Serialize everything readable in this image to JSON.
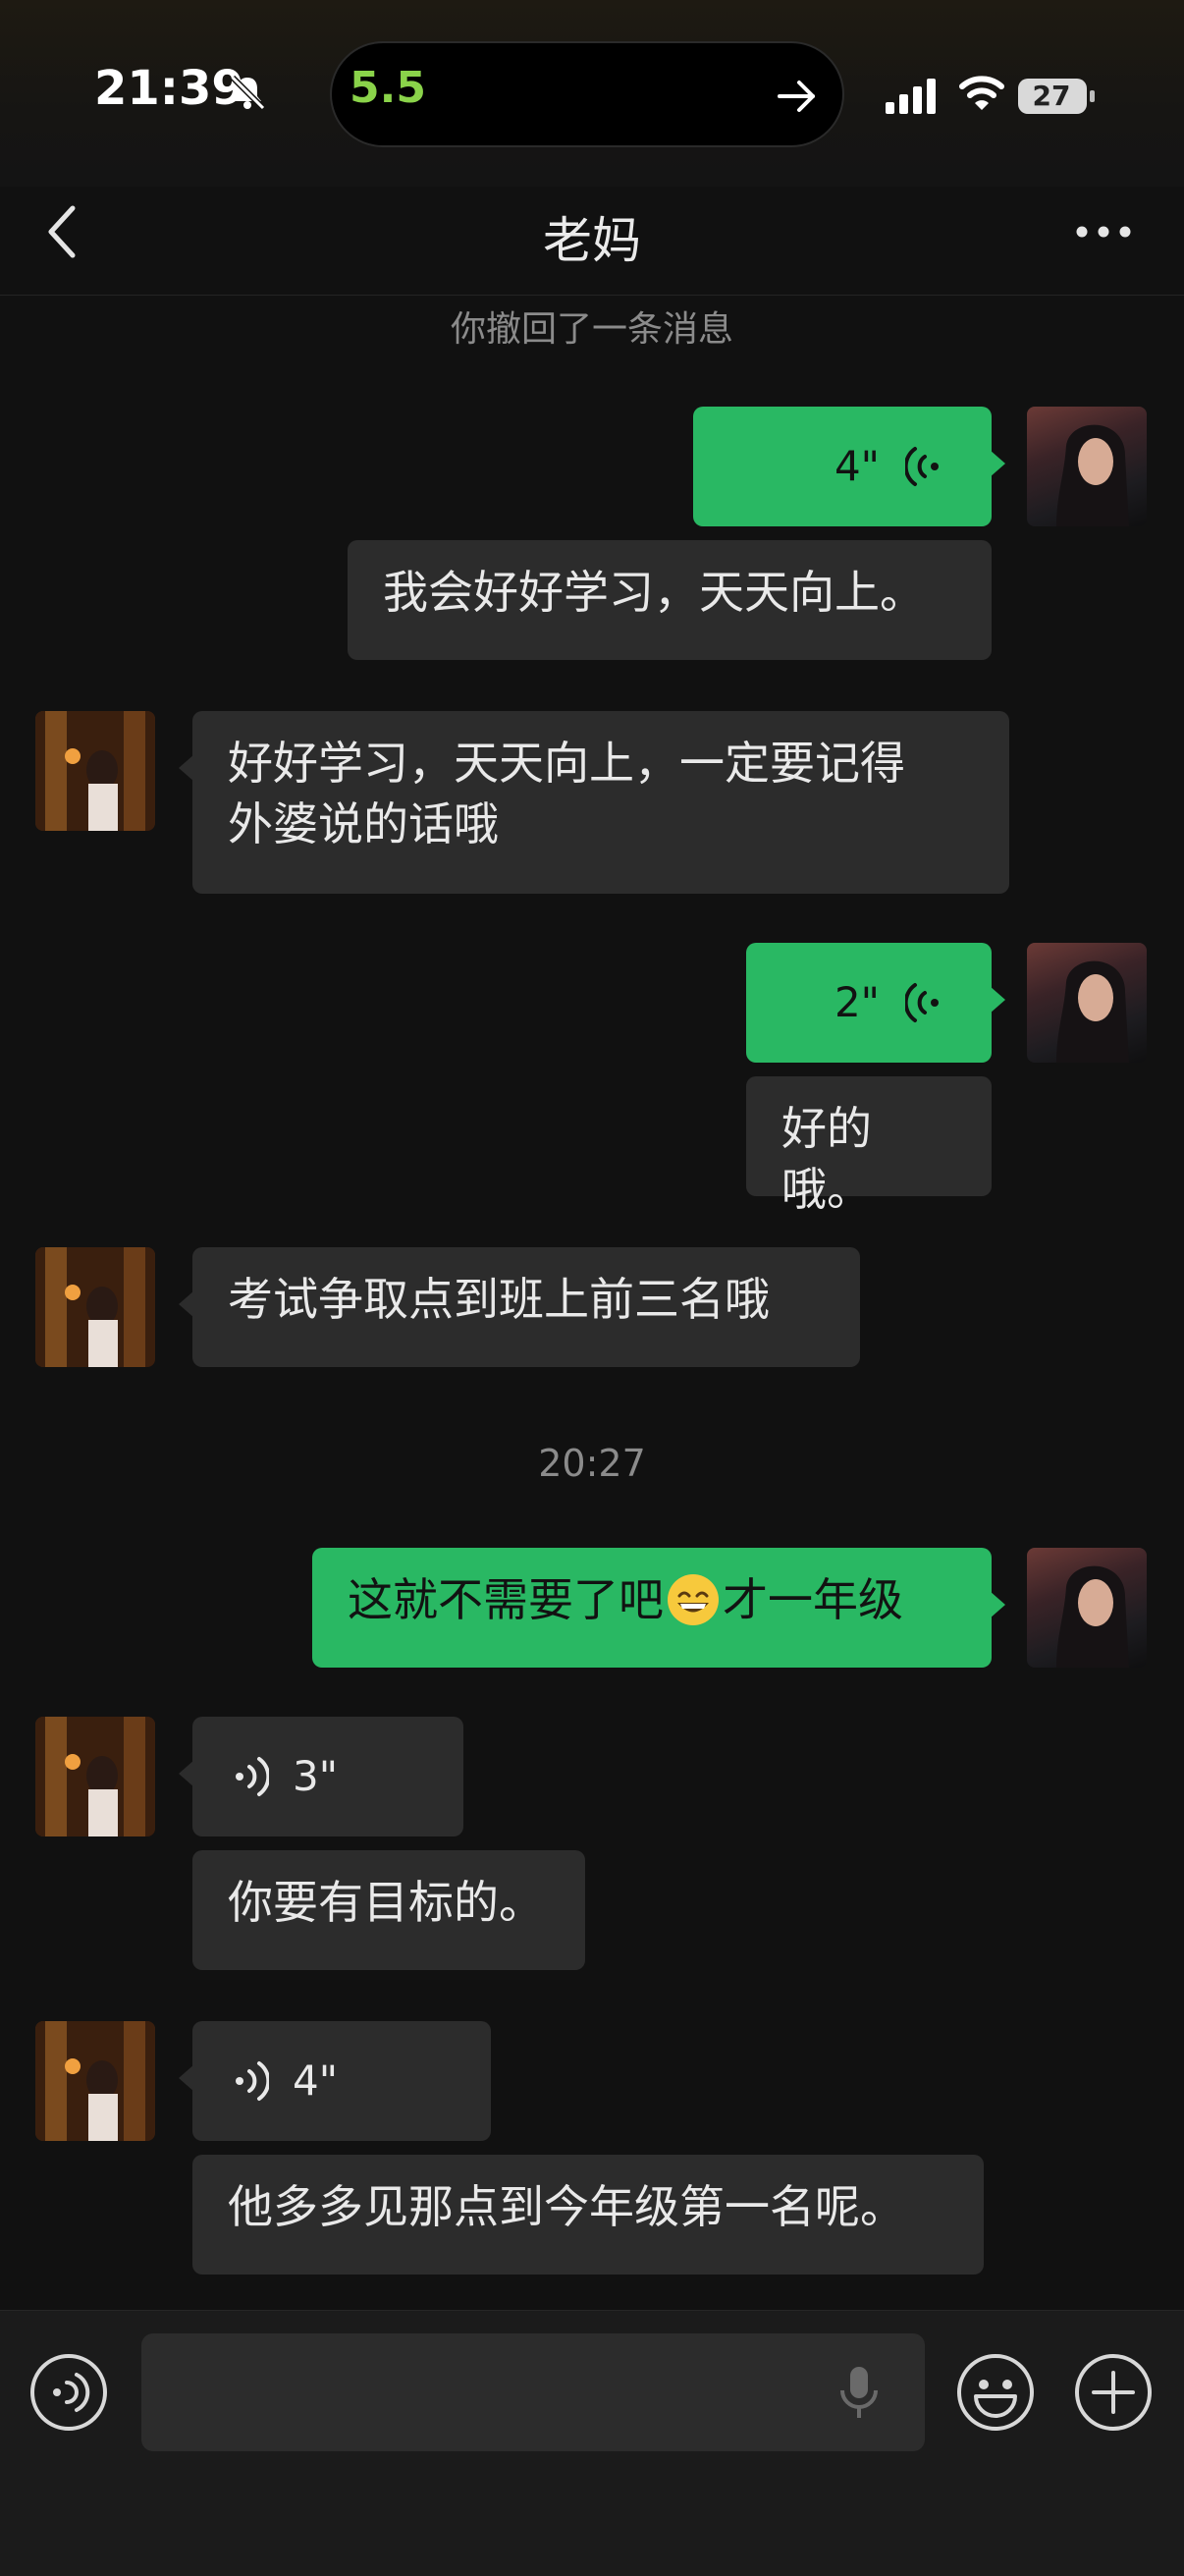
{
  "status_bar": {
    "time": "21:39",
    "island_value": "5.5",
    "battery": "27",
    "icons": [
      "bell-slash-icon",
      "arrow-right-icon",
      "signal-icon",
      "wifi-icon",
      "battery-icon"
    ]
  },
  "header": {
    "title": "老妈",
    "back_icon": "chevron-left-icon",
    "more_icon": "more-horizontal-icon"
  },
  "messages": {
    "recall_notice": "你撤回了一条消息",
    "voice_1_duration": "4\"",
    "text_1": "我会好好学习，天天向上。",
    "text_2_line1": "好好学习，天天向上，一定要记得",
    "text_2_line2": "外婆说的话哦",
    "voice_2_duration": "2\"",
    "text_3": "好的哦。",
    "text_4": "考试争取点到班上前三名哦",
    "timestamp": "20:27",
    "text_5_before": "这就不需要了吧",
    "text_5_emoji": "grinning-face-emoji",
    "text_5_after": "才一年级",
    "voice_3_duration": "3\"",
    "text_6": "你要有目标的。",
    "voice_4_duration": "4\"",
    "text_7": "他多多见那点到今年级第一名呢。"
  },
  "input_bar": {
    "voice_toggle_icon": "voice-wave-icon",
    "mic_icon": "microphone-icon",
    "emoji_icon": "smiley-icon",
    "plus_icon": "plus-icon"
  },
  "colors": {
    "background": "#111111",
    "sent_bubble": "#29b863",
    "received_bubble": "#2c2c2c",
    "island_text": "#8ad34a"
  }
}
